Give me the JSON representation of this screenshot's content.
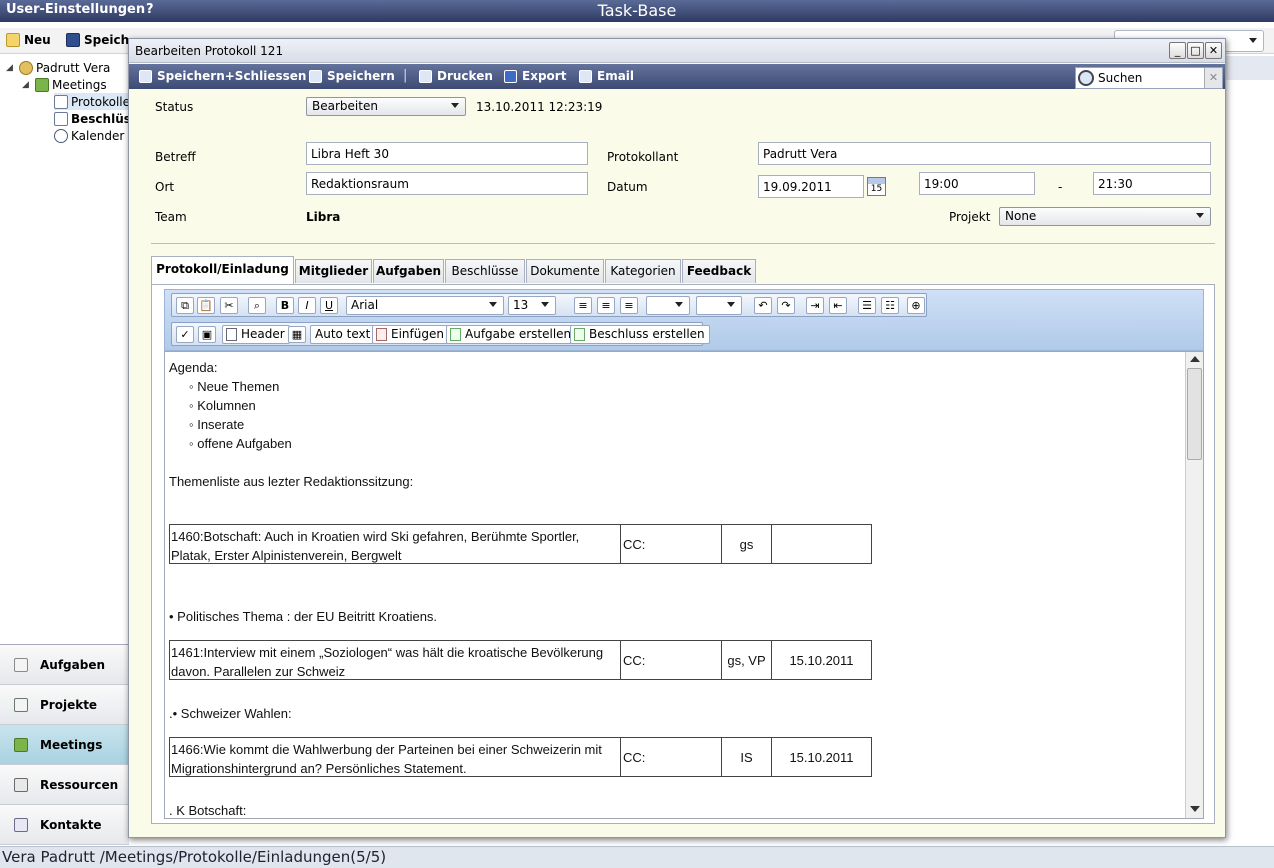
{
  "app": {
    "title": "Task-Base",
    "user_settings": "User-Einstellungen",
    "help": "?"
  },
  "main_toolbar": {
    "new": "Neu",
    "save": "Speich"
  },
  "tree": {
    "root": "Padrutt Vera",
    "meetings": "Meetings",
    "items": [
      "Protokolle",
      "Beschlüsse",
      "Kalender"
    ]
  },
  "nav": [
    "Aufgaben",
    "Projekte",
    "Meetings",
    "Ressourcen",
    "Kontakte"
  ],
  "statusbar": "Vera Padrutt /Meetings/Protokolle/Einladungen(5/5)",
  "dialog": {
    "title": "Bearbeiten Protokoll 121",
    "win": {
      "min": "_",
      "max": "□",
      "close": "✕"
    },
    "toolbar": {
      "save_close": "Speichern+Schliessen",
      "save": "Speichern",
      "sep": "|",
      "print": "Drucken",
      "export": "Export",
      "email": "Email"
    },
    "search": {
      "value": "Suchen",
      "clear": "✕"
    },
    "form": {
      "status_label": "Status",
      "status_value": "Bearbeiten",
      "status_time": "13.10.2011 12:23:19",
      "betreff_label": "Betreff",
      "betreff_value": "Libra Heft 30",
      "protokollant_label": "Protokollant",
      "protokollant_value": "Padrutt Vera",
      "ort_label": "Ort",
      "ort_value": "Redaktionsraum",
      "datum_label": "Datum",
      "datum_value": "19.09.2011",
      "cal_day": "15",
      "start_time": "19:00",
      "dash": "-",
      "end_time": "21:30",
      "team_label": "Team",
      "team_value": "Libra",
      "projekt_label": "Projekt",
      "projekt_value": "None"
    },
    "tabs": [
      "Protokoll/Einladung",
      "Mitglieder",
      "Aufgaben",
      "Beschlüsse",
      "Dokumente",
      "Kategorien",
      "Feedback"
    ],
    "editor_toolbar": {
      "bold": "B",
      "italic": "I",
      "underline": "U",
      "font": "Arial",
      "size": "13",
      "header": "Header",
      "autotext": "Auto text",
      "insert": "Einfügen",
      "create_task": "Aufgabe erstellen",
      "create_decision": "Beschluss erstellen"
    },
    "document": {
      "agenda": "Agenda:",
      "bullets": [
        "◦ Neue Themen",
        "◦ Kolumnen",
        "◦ Inserate",
        "◦ offene Aufgaben"
      ],
      "themenliste": "Themenliste aus lezter Redaktionssitzung:",
      "row1": {
        "text1": "1460:Botschaft: Auch in Kroatien wird Ski gefahren, Berühmte Sportler,",
        "text2": "Platak,  Erster Alpinistenverein, Bergwelt",
        "cc": "CC:",
        "who": "gs",
        "date": ""
      },
      "politisch": "• Politisches Thema : der EU Beitritt Kroatiens.",
      "row2": {
        "text1": "1461:Interview mit einem „Soziologen“ was hält die kroatische Bevölkerung",
        "text2": "davon. Parallelen zur Schweiz",
        "cc": "CC:",
        "who": "gs, VP",
        "date": "15.10.2011"
      },
      "wahlen": ".• Schweizer Wahlen:",
      "row3": {
        "text1": "1466:Wie kommt die Wahlwerbung der Parteinen bei einer Schweizerin mit",
        "text2": "Migrationshintergrund an? Persönliches Statement.",
        "cc": "CC:",
        "who": "IS",
        "date": "15.10.2011"
      },
      "kbotschaft": ". K Botschaft:"
    }
  }
}
